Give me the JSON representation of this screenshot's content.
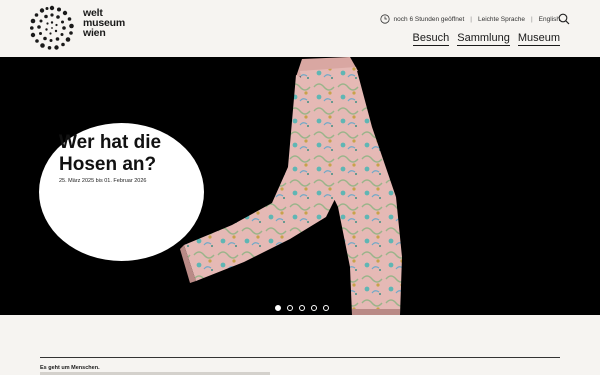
{
  "brand": {
    "line1": "welt",
    "line2": "museum",
    "line3": "wien"
  },
  "utility": {
    "opening": "noch 6 Stunden geöffnet",
    "easy_language": "Leichte Sprache",
    "language": "English",
    "separator": "|"
  },
  "nav": {
    "items": [
      "Besuch",
      "Sammlung",
      "Museum"
    ]
  },
  "hero": {
    "title": "Wer hat die Hosen an?",
    "date": "25. März 2025 bis 01. Februar 2026",
    "slides": {
      "count": 5,
      "active": 1
    }
  },
  "intro": {
    "title": "Es geht um Menschen."
  },
  "colors": {
    "background": "#f6f4f1",
    "hero": "#000000",
    "text": "#1a1a1a",
    "fabric": "#e3b6b3"
  }
}
